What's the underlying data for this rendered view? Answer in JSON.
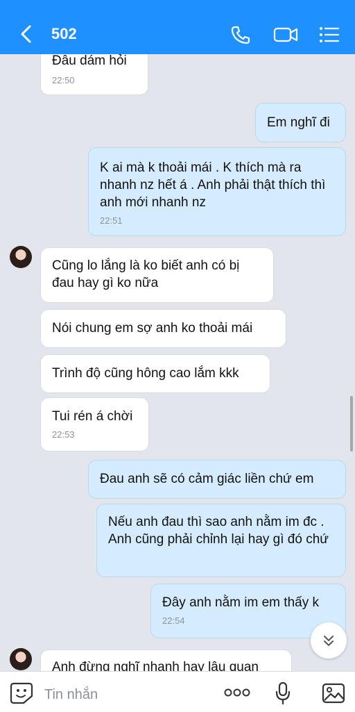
{
  "header": {
    "title": "502",
    "back_icon": "chevron-left-icon",
    "call_icon": "phone-icon",
    "video_icon": "video-icon",
    "menu_icon": "list-menu-icon",
    "accent": "#1e90ff"
  },
  "messages": [
    {
      "side": "in",
      "text": "Đâu dám hỏi",
      "time": "22:50"
    },
    {
      "side": "out",
      "text": "Em nghĩ đi"
    },
    {
      "side": "out",
      "text": "K ai mà k thoải mái . K thích mà ra nhanh nz hết á . Anh phải thật thích thì anh mới nhanh nz",
      "time": "22:51"
    },
    {
      "side": "in",
      "text": "Cũng lo lắng là ko biết anh có bị đau hay gì ko nữa"
    },
    {
      "side": "in",
      "text": "Nói chung em sợ anh ko thoải mái"
    },
    {
      "side": "in",
      "text": "Trình độ cũng hông cao lắm kkk"
    },
    {
      "side": "in",
      "text": "Tui rén á chời",
      "time": "22:53"
    },
    {
      "side": "out",
      "text": "Đau anh sẽ có cảm giác liền chứ em"
    },
    {
      "side": "out",
      "text": "Nếu anh đau thì sao anh nằm im đc . Anh cũng phải chỉnh lại hay gì đó chứ"
    },
    {
      "side": "out",
      "text": "Đây anh nằm im em thấy k",
      "time": "22:54"
    },
    {
      "side": "in",
      "text": "Anh đừng nghĩ nhanh hay lâu quan"
    }
  ],
  "input": {
    "placeholder": "Tin nhắn",
    "emoji_icon": "emoji-sticker-icon",
    "more_icon": "more-dots-icon",
    "mic_icon": "microphone-icon",
    "image_icon": "image-icon"
  },
  "scroll_down_icon": "double-chevron-down-icon"
}
